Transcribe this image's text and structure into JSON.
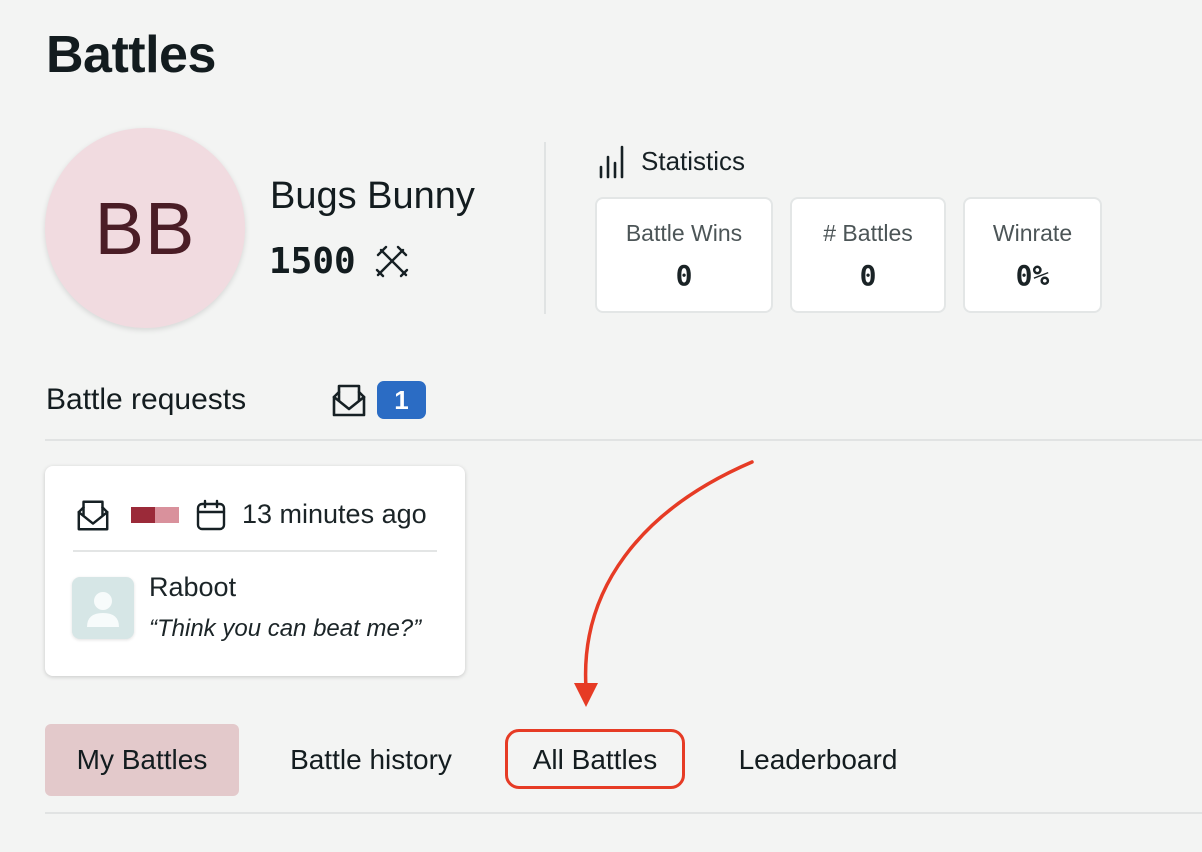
{
  "page": {
    "title": "Battles"
  },
  "profile": {
    "initials": "BB",
    "name": "Bugs Bunny",
    "rating": "1500",
    "rating_icon": "crossed-swords-icon",
    "avatar_color": "#f1dbe0"
  },
  "statistics": {
    "title": "Statistics",
    "icon": "bar-chart-icon",
    "cards": [
      {
        "label": "Battle Wins",
        "value": "0"
      },
      {
        "label": "# Battles",
        "value": "0"
      },
      {
        "label": "Winrate",
        "value": "0%"
      }
    ]
  },
  "battle_requests": {
    "title": "Battle requests",
    "icon": "mail-open-icon",
    "count": "1",
    "badge_color": "#2b6cc4",
    "items": [
      {
        "icon": "mail-open-icon",
        "colors": [
          "#9b2a39",
          "#d9919c"
        ],
        "time_icon": "calendar-icon",
        "time": "13 minutes ago",
        "opponent": "Raboot",
        "message": "“Think you can beat me?”"
      }
    ]
  },
  "tabs": [
    {
      "label": "My Battles",
      "active": true
    },
    {
      "label": "Battle history",
      "active": false
    },
    {
      "label": "All Battles",
      "active": false
    },
    {
      "label": "Leaderboard",
      "active": false
    }
  ],
  "annotation": {
    "color": "#e63b25",
    "highlighted_tab": "All Battles"
  }
}
